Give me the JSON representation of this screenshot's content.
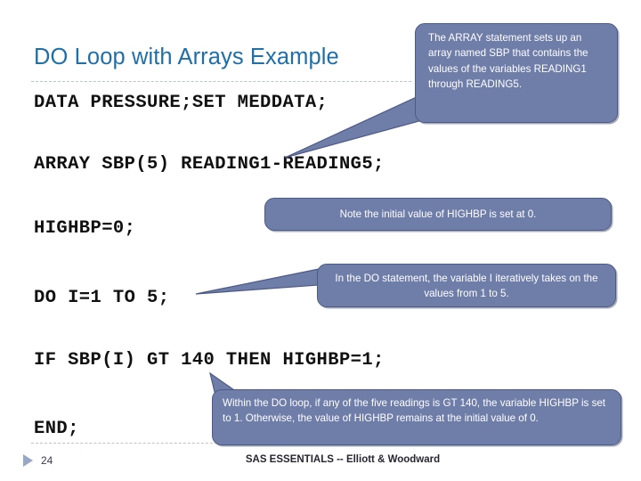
{
  "slide": {
    "title": "DO Loop with Arrays Example",
    "title_color": "#1F6FA9",
    "background": "#FFFFFF"
  },
  "code_lines": [
    "DATA PRESSURE;SET MEDDATA;",
    "ARRAY SBP(5) READING1-READING5;",
    "HIGHBP=0;",
    "DO I=1 TO 5;",
    "IF SBP(I) GT 140 THEN HIGHBP=1;",
    "END;"
  ],
  "callouts": [
    {
      "id": "array",
      "text": "The ARRAY statement sets up an array named SBP that contains the values of the variables READING1 through READING5.",
      "fill": "#6F7DA9",
      "border": "#4D5A87"
    },
    {
      "id": "highbp",
      "text": "Note the initial value of HIGHBP is set at 0.",
      "fill": "#6F7DA9",
      "border": "#4D5A87"
    },
    {
      "id": "do",
      "text": "In the DO statement, the variable I iteratively takes on the values from 1 to 5.",
      "fill": "#6F7DA9",
      "border": "#4D5A87"
    },
    {
      "id": "if",
      "text": "Within the DO loop, if any of the five readings is GT 140, the variable HIGHBP is set to 1. Otherwise, the value of HIGHBP remains at the initial value of 0.",
      "fill": "#6F7DA9",
      "border": "#4D5A87"
    }
  ],
  "footer": {
    "page_number": "24",
    "center_text": "SAS ESSENTIALS -- Elliott & Woodward",
    "triangle_color": "#9AA7C4"
  }
}
